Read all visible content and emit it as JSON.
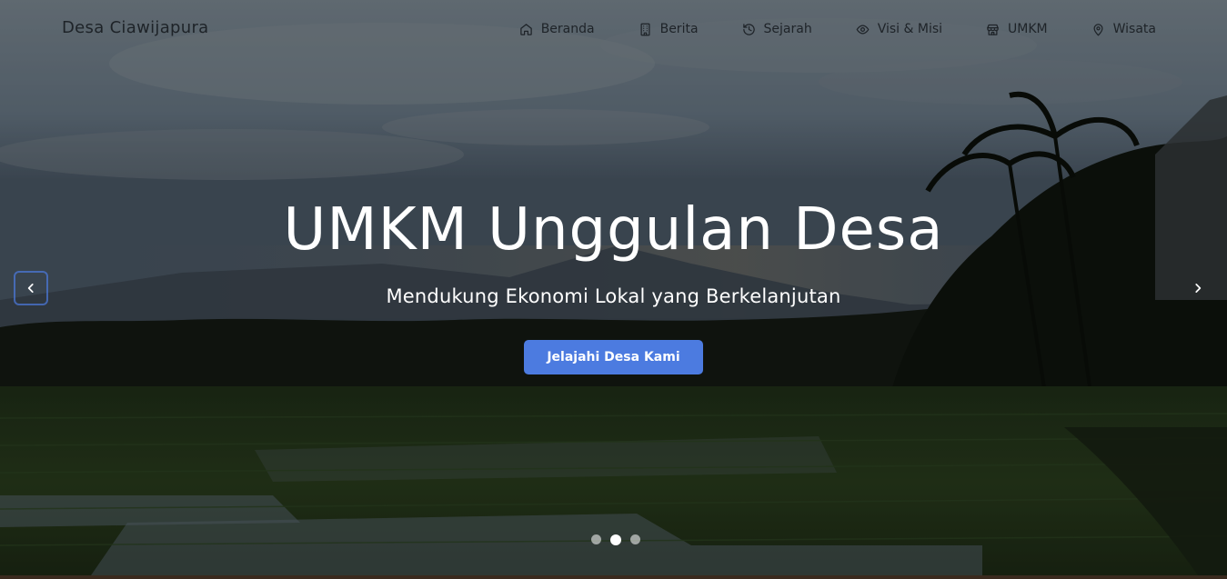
{
  "brand": {
    "name": "Desa Ciawijapura"
  },
  "nav": {
    "items": [
      {
        "label": "Beranda",
        "icon": "home-icon"
      },
      {
        "label": "Berita",
        "icon": "building-icon"
      },
      {
        "label": "Sejarah",
        "icon": "history-icon"
      },
      {
        "label": "Visi & Misi",
        "icon": "eye-icon"
      },
      {
        "label": "UMKM",
        "icon": "store-icon"
      },
      {
        "label": "Wisata",
        "icon": "map-pin-icon"
      }
    ]
  },
  "hero": {
    "title": "UMKM Unggulan Desa",
    "subtitle": "Mendukung Ekonomi Lokal yang Berkelanjutan",
    "cta_label": "Jelajahi Desa Kami",
    "slide_count": 3,
    "active_slide": 2
  },
  "colors": {
    "accent": "#4c7be0",
    "text_dark": "#1e2328",
    "text_light": "#ffffff"
  }
}
